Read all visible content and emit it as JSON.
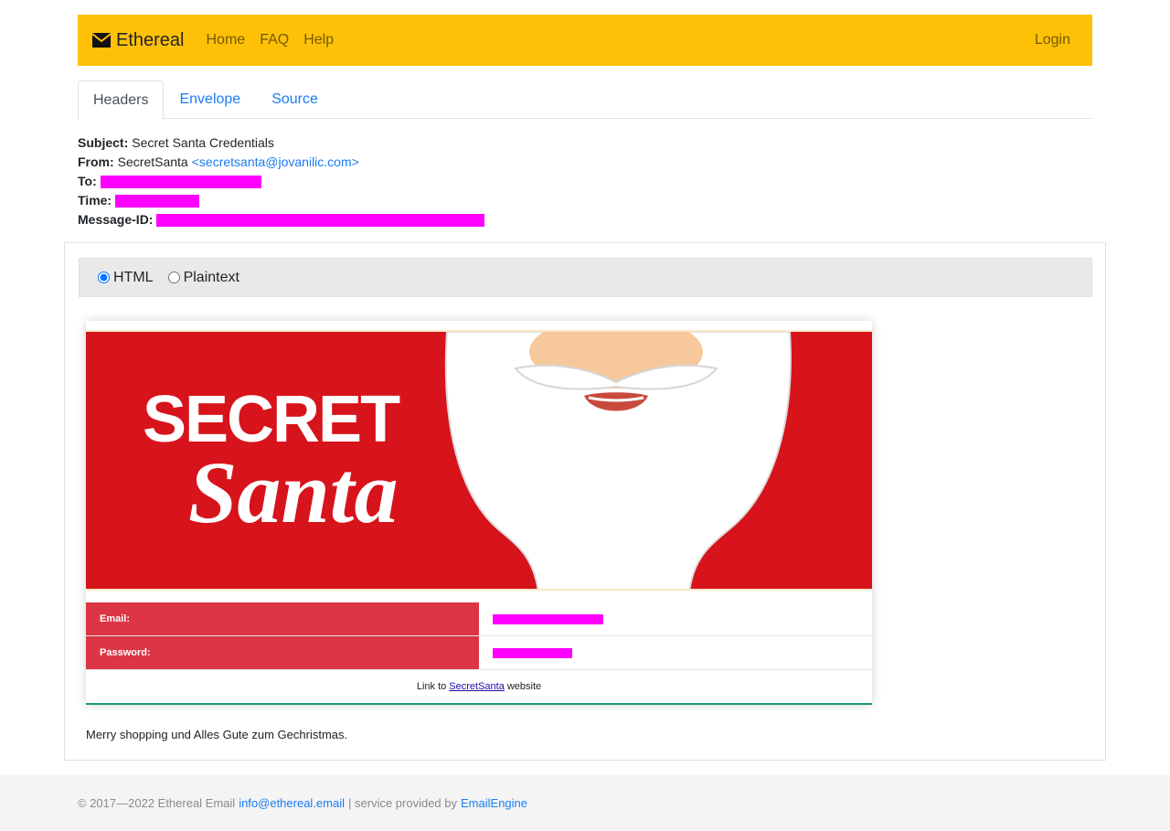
{
  "navbar": {
    "brand": "Ethereal",
    "links": [
      "Home",
      "FAQ",
      "Help"
    ],
    "login": "Login"
  },
  "tabs": [
    "Headers",
    "Envelope",
    "Source"
  ],
  "headers": {
    "subject_label": "Subject:",
    "subject": "Secret Santa Credentials",
    "from_label": "From:",
    "from_name": "SecretSanta",
    "from_email": "<secretsanta@jovanilic.com>",
    "to_label": "To:",
    "time_label": "Time:",
    "message_id_label": "Message-ID:"
  },
  "view": {
    "html_label": "HTML",
    "plaintext_label": "Plaintext",
    "selected": "HTML"
  },
  "email": {
    "banner_line1": "SECRET",
    "banner_line2": "Santa",
    "email_label": "Email:",
    "password_label": "Password:",
    "link_prefix": "Link to",
    "link_text": "SecretSanta",
    "link_suffix": "website",
    "closing": "Merry shopping und Alles Gute zum Gechristmas."
  },
  "footer": {
    "copyright": "© 2017—2022 Ethereal Email",
    "contact": "info@ethereal.email",
    "service": "| service provided by",
    "provider": "EmailEngine"
  },
  "colors": {
    "navbar": "#ffc107",
    "redaction": "#ff00ff",
    "cred_label_bg": "#dc3545",
    "banner_red": "#d7131b"
  }
}
